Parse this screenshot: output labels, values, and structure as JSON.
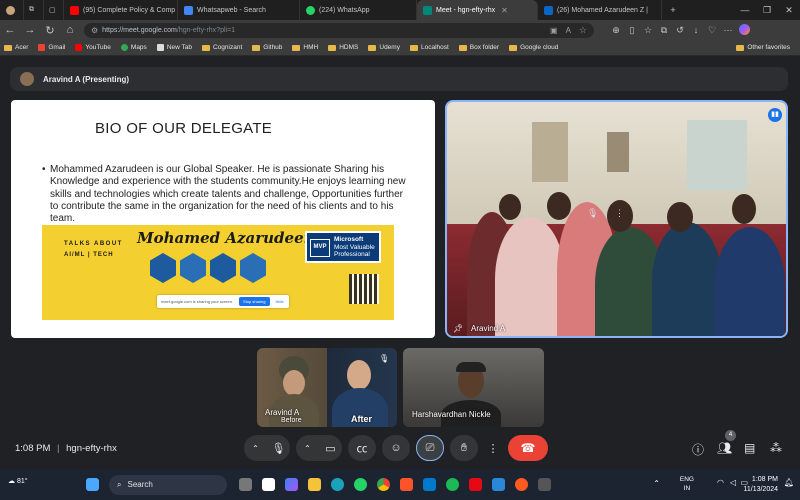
{
  "browser": {
    "tabs": [
      {
        "title": "(95) Complete Policy & Comp",
        "color": "#ff0000",
        "active": false
      },
      {
        "title": "Whatsapweb - Search",
        "color": "#4285f4",
        "active": false
      },
      {
        "title": "(224) WhatsApp",
        "color": "#25d366",
        "active": false
      },
      {
        "title": "Meet - hgn-efty-rhx",
        "color": "#00897b",
        "active": true
      },
      {
        "title": "(26) Mohamed Azarudeen Z |",
        "color": "#0a66c2",
        "active": false
      }
    ],
    "url_host": "https://meet.google.com",
    "url_path": "/hgn-efty-rhx?pli=1",
    "bookmarks": [
      {
        "label": "Acer",
        "icon": "folder-icon"
      },
      {
        "label": "Gmail",
        "icon": "gmail-icon"
      },
      {
        "label": "YouTube",
        "icon": "youtube-icon"
      },
      {
        "label": "Maps",
        "icon": "maps-icon"
      },
      {
        "label": "New Tab",
        "icon": "page-icon"
      },
      {
        "label": "Cognizant",
        "icon": "folder-icon"
      },
      {
        "label": "Github",
        "icon": "folder-icon"
      },
      {
        "label": "HMH",
        "icon": "folder-icon"
      },
      {
        "label": "HDMS",
        "icon": "folder-icon"
      },
      {
        "label": "Udemy",
        "icon": "folder-icon"
      },
      {
        "label": "Localhost",
        "icon": "folder-icon"
      },
      {
        "label": "Box folder",
        "icon": "folder-icon"
      },
      {
        "label": "Google cloud",
        "icon": "folder-icon"
      }
    ],
    "other_favorites": "Other favorites"
  },
  "meet": {
    "presenting_label": "Aravind A (Presenting)",
    "slide": {
      "title": "BIO OF OUR DELEGATE",
      "body": "Mohammed Azarudeen is our  Global Speaker. He is passionate Sharing his Knowledge and experience with the students community.He enjoys learning new skills and technologies which create talents and challenge, Opportunities further to contribute the  same in the organization for the need of his clients  and to his team.",
      "banner": {
        "talks_about": "TALKS ABOUT",
        "topics": "AI/ML | TECH",
        "signature": "Mohamed Azarudeen Z",
        "mvp": "MVP",
        "mvp_title": "Microsoft",
        "mvp_sub1": "Most Valuable",
        "mvp_sub2": "Professional",
        "share_text": "meet.google.com is sharing your screen.",
        "stop_sharing": "Stop sharing",
        "hide": "Hide"
      }
    },
    "tiles": {
      "main_name": "Aravind A",
      "aravind_name": "Aravind A",
      "aravind_caption_before": "Before",
      "aravind_caption_after": "After",
      "harsha_name": "Harshavardhan Nickle"
    },
    "meeting_time": "1:08 PM",
    "meeting_code": "hgn-efty-rhx",
    "people_count": "4"
  },
  "taskbar": {
    "weather_temp": "81°",
    "search_placeholder": "Search",
    "lang_line1": "ENG",
    "lang_line2": "IN",
    "clock_time": "1:08 PM",
    "clock_date": "11/13/2024"
  },
  "colors": {
    "accent_blue": "#8ab4f8",
    "end_call_red": "#ea4335",
    "banner_yellow": "#f3cf2f"
  }
}
